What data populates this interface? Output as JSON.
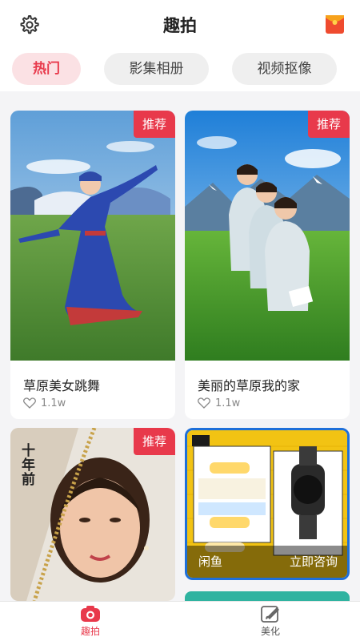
{
  "header": {
    "title": "趣拍",
    "settings_icon": "gear-icon",
    "gift_icon": "red-envelope-icon"
  },
  "tabs": [
    {
      "label": "热门",
      "active": true
    },
    {
      "label": "影集相册",
      "active": false
    },
    {
      "label": "视频抠像",
      "active": false
    }
  ],
  "cards": [
    {
      "title": "草原美女跳舞",
      "likes": "1.1w",
      "badge": "推荐"
    },
    {
      "title": "美丽的草原我的家",
      "likes": "1.1w",
      "badge": "推荐"
    },
    {
      "badge": "推荐",
      "image_text": "十年前"
    },
    {
      "overlay_left": "闲鱼",
      "overlay_right": "立即咨询"
    }
  ],
  "nav": [
    {
      "label": "趣拍",
      "icon": "camera-icon",
      "active": true
    },
    {
      "label": "美化",
      "icon": "brush-icon",
      "active": false
    }
  ],
  "colors": {
    "accent": "#e8394b",
    "tab_active_bg": "#fbe1e4"
  }
}
